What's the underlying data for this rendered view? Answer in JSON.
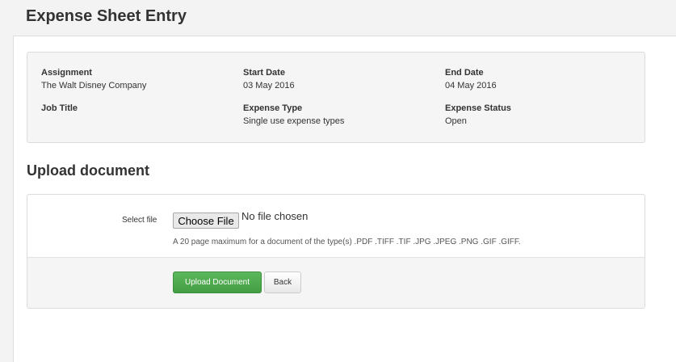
{
  "header": {
    "title": "Expense Sheet Entry"
  },
  "summary": {
    "assignment_label": "Assignment",
    "assignment_value": "The Walt Disney Company",
    "start_date_label": "Start Date",
    "start_date_value": "03 May 2016",
    "end_date_label": "End Date",
    "end_date_value": "04 May 2016",
    "job_title_label": "Job Title",
    "job_title_value": "",
    "expense_type_label": "Expense Type",
    "expense_type_value": "Single use expense types",
    "expense_status_label": "Expense Status",
    "expense_status_value": "Open"
  },
  "upload": {
    "section_title": "Upload document",
    "select_file_label": "Select file",
    "choose_file_label": "Choose File",
    "no_file_text": "No file chosen",
    "help_text": "A 20 page maximum for a document of the type(s) .PDF .TIFF .TIF .JPG .JPEG .PNG .GIF .GIFF.",
    "upload_button_label": "Upload Document",
    "back_button_label": "Back"
  },
  "colors": {
    "primary_button": "#5cb85c",
    "panel_background": "#f5f5f5",
    "page_background": "#f3f3f3"
  }
}
